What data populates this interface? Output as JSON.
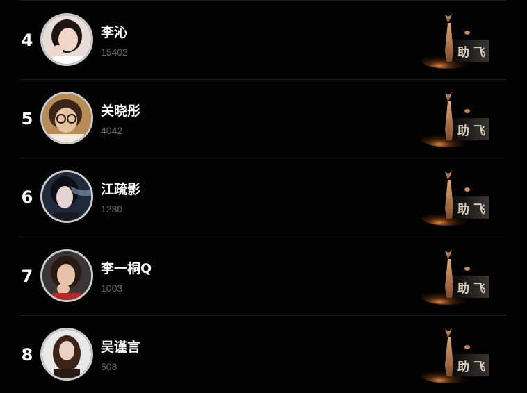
{
  "list": {
    "items": [
      {
        "rank": "4",
        "name": "李沁",
        "count": "15402",
        "avatar_bg": "#e9dcd6",
        "hair": "#1d1414",
        "skin": "#f1d6c8"
      },
      {
        "rank": "5",
        "name": "关晓彤",
        "count": "4042",
        "avatar_bg": "#b98b55",
        "hair": "#3a2618",
        "skin": "#e7c2a0"
      },
      {
        "rank": "6",
        "name": "江疏影",
        "count": "1280",
        "avatar_bg": "#1f2a3a",
        "hair": "#0e0f14",
        "skin": "#e4d4d4"
      },
      {
        "rank": "7",
        "name": "李一桐Q",
        "count": "1003",
        "avatar_bg": "#3b3434",
        "hair": "#2a1a14",
        "skin": "#e6c3a8"
      },
      {
        "rank": "8",
        "name": "吴谨言",
        "count": "508",
        "avatar_bg": "#e8e8e8",
        "hair": "#3d2418",
        "skin": "#ecd1c0"
      }
    ],
    "support_label": "助飞"
  },
  "colors": {
    "background": "#020202",
    "separator": "#1c1c1c",
    "count_text": "#6a6a6a",
    "avatar_ring": "#c9c9c9",
    "trophy_gold": "#c58a52"
  }
}
